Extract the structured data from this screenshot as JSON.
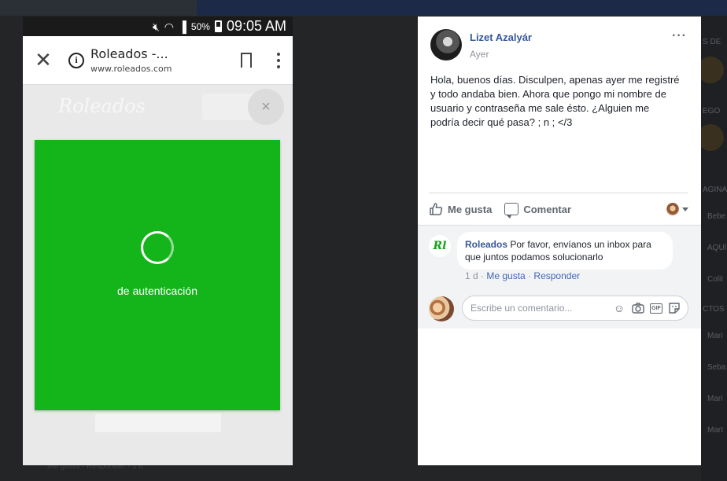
{
  "background": {
    "right_items": [
      "S DE",
      "EGO",
      "AGINA",
      "Bebe",
      "AQUÍ",
      "Colit",
      "CTOS",
      "Mari",
      "Seba",
      "Mari",
      "Mart"
    ],
    "bottom_text": "Me gusta · Responder · 1 d"
  },
  "phone": {
    "status": {
      "battery": "50%",
      "time": "09:05 AM"
    },
    "browser": {
      "title": "Roleados -...",
      "url": "www.roleados.com"
    },
    "site_logo": "Roleados",
    "close_glyph": "×",
    "auth_text": "de autenticación",
    "colors": {
      "card": "#14b51a"
    }
  },
  "post": {
    "author": "Lizet Azalyár",
    "time": "Ayer",
    "menu": "···",
    "body": "Hola, buenos días. Disculpen, apenas ayer me registré y todo andaba bien. Ahora que pongo mi nombre de usuario y contraseña me sale ésto. ¿Alguien me podría decir qué pasa? ; n ; </3",
    "actions": {
      "like": "Me gusta",
      "comment": "Comentar"
    },
    "comment": {
      "avatar_text": "Rl",
      "author": "Roleados",
      "text": "Por favor, envíanos un inbox para que juntos podamos solucionarlo",
      "age": "1 d",
      "sep": "·",
      "like": "Me gusta",
      "reply": "Responder"
    },
    "composer": {
      "placeholder": "Escribe un comentario..."
    },
    "icons": [
      "thumbs-up-icon",
      "comment-icon",
      "smiley-icon",
      "camera-icon",
      "gif-icon",
      "sticker-icon"
    ]
  }
}
